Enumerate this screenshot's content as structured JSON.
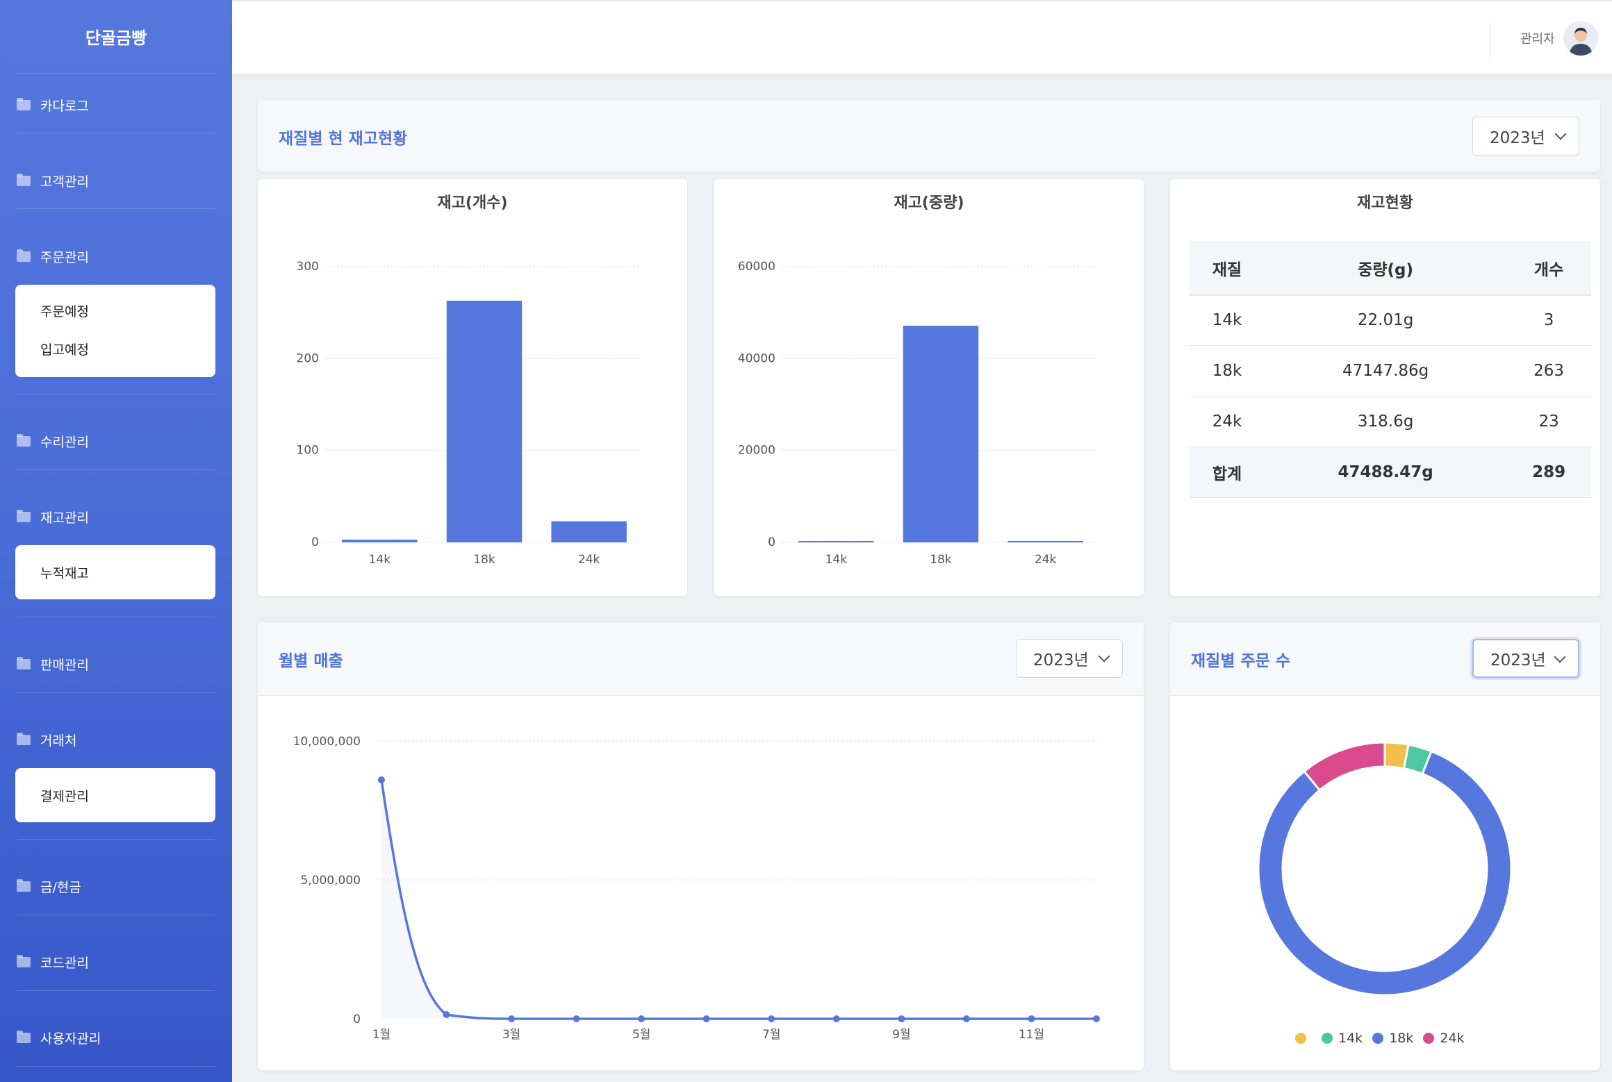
{
  "brand": "단골금빵",
  "nav": [
    {
      "label": "카다로그"
    },
    {
      "label": "고객관리"
    },
    {
      "label": "주문관리"
    },
    {
      "label": "수리관리"
    },
    {
      "label": "재고관리"
    },
    {
      "label": "판매관리"
    },
    {
      "label": "거래처"
    },
    {
      "label": "금/현금"
    },
    {
      "label": "코드관리"
    },
    {
      "label": "사용자관리"
    }
  ],
  "subnav": {
    "order": [
      "주문예정",
      "입고예정"
    ],
    "stock": [
      "누적재고"
    ],
    "partner": [
      "결제관리"
    ]
  },
  "user": {
    "name": "관리자"
  },
  "stock_card": {
    "title": "재질별 현 재고현황",
    "year": "2023년"
  },
  "sales_card": {
    "title": "월별 매출",
    "year": "2023년"
  },
  "orders_card": {
    "title": "재질별 주문 수",
    "year": "2023년"
  },
  "inventory_table": {
    "title": "재고현황",
    "headers": [
      "재질",
      "중량(g)",
      "개수"
    ],
    "rows": [
      [
        "14k",
        "22.01g",
        "3"
      ],
      [
        "18k",
        "47147.86g",
        "263"
      ],
      [
        "24k",
        "318.6g",
        "23"
      ]
    ],
    "total": [
      "합계",
      "47488.47g",
      "289"
    ]
  },
  "colors": {
    "primary": "#5677dd",
    "green": "#4cc9a0",
    "yellow": "#f2c04a",
    "pink": "#d94b8c"
  },
  "chart_data": [
    {
      "type": "bar",
      "title": "재고(개수)",
      "categories": [
        "14k",
        "18k",
        "24k"
      ],
      "values": [
        3,
        263,
        23
      ],
      "ylim": [
        0,
        300
      ],
      "yticks": [
        0,
        100,
        200,
        300
      ],
      "grid": true
    },
    {
      "type": "bar",
      "title": "재고(중량)",
      "categories": [
        "14k",
        "18k",
        "24k"
      ],
      "values": [
        22.01,
        47147.86,
        318.6
      ],
      "ylim": [
        0,
        60000
      ],
      "yticks": [
        0,
        20000,
        40000,
        60000
      ],
      "grid": true
    },
    {
      "type": "line",
      "x": [
        "1월",
        "2월",
        "3월",
        "4월",
        "5월",
        "6월",
        "7월",
        "8월",
        "9월",
        "10월",
        "11월",
        "12월"
      ],
      "xtick_labels": [
        "1월",
        "3월",
        "5월",
        "7월",
        "9월",
        "11월"
      ],
      "values": [
        8600000,
        150000,
        0,
        0,
        0,
        0,
        0,
        0,
        0,
        0,
        0,
        0
      ],
      "ylim": [
        0,
        10000000
      ],
      "yticks": [
        "0",
        "5,000,000",
        "10,000,000"
      ],
      "grid": true
    },
    {
      "type": "pie",
      "donut": true,
      "labels": [
        "",
        "14k",
        "18k",
        "24k"
      ],
      "values": [
        3,
        3,
        83,
        11
      ],
      "colors": [
        "#f2c04a",
        "#4cc9a0",
        "#5677dd",
        "#d94b8c"
      ],
      "legend": "bottom"
    }
  ]
}
